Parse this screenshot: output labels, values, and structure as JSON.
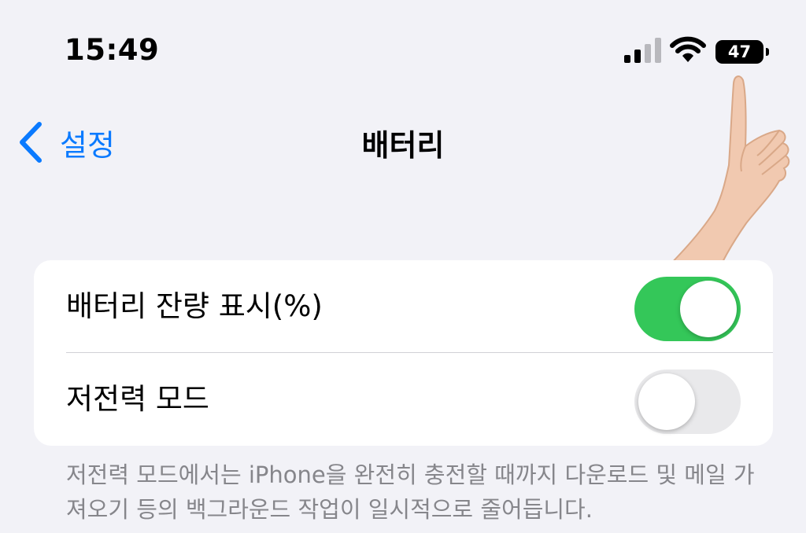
{
  "status_bar": {
    "time": "15:49",
    "battery_level": "47",
    "icons": [
      "cellular-signal-icon",
      "wifi-icon",
      "battery-icon"
    ]
  },
  "nav": {
    "back_label": "설정",
    "title": "배터리"
  },
  "settings": {
    "battery_percentage": {
      "label": "배터리 잔량 표시(%)",
      "enabled": true
    },
    "low_power_mode": {
      "label": "저전력 모드",
      "enabled": false
    }
  },
  "footnote": "저전력 모드에서는 iPhone을 완전히 충전할 때까지 다운로드 및 메일 가져오기 등의 백그라운드 작업이 일시적으로 줄어듭니다.",
  "colors": {
    "accent": "#0a7aff",
    "toggle_on": "#34c759",
    "toggle_off": "#e9e9eb",
    "background": "#f2f2f7"
  }
}
